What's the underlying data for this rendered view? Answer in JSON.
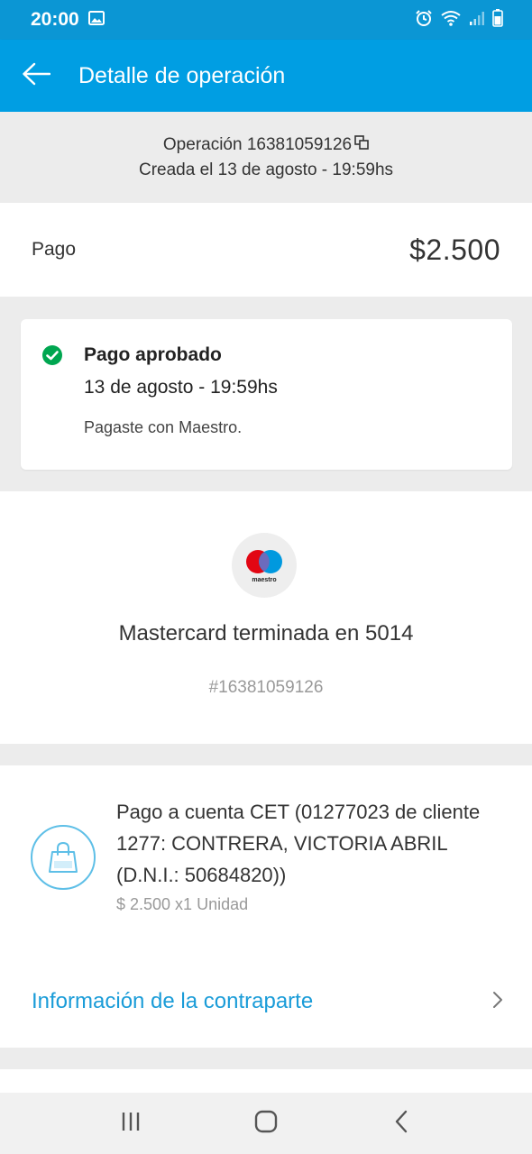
{
  "status_bar": {
    "time": "20:00",
    "icons": [
      "image-icon",
      "alarm-icon",
      "wifi-icon",
      "signal-icon",
      "battery-icon"
    ]
  },
  "app_bar": {
    "title": "Detalle de operación",
    "back_icon": "arrow-left-icon"
  },
  "operation": {
    "number_line": "Operación 16381059126",
    "copy_icon": "copy-icon",
    "created_line": "Creada el 13 de agosto - 19:59hs"
  },
  "payment": {
    "label": "Pago",
    "amount": "$2.500"
  },
  "status_card": {
    "title": "Pago aprobado",
    "date": "13 de agosto - 19:59hs",
    "method": "Pagaste con Maestro.",
    "status_color": "#00a650"
  },
  "card": {
    "brand_logo_text": "maestro",
    "name": "Mastercard terminada en 5014",
    "reference": "#16381059126"
  },
  "item": {
    "description": "Pago a cuenta CET (01277023 de cliente 1277: CONTRERA, VICTORIA ABRIL (D.N.I.: 50684820))",
    "price": "$ 2.500 x1 Unidad",
    "icon": "shopping-bag-icon"
  },
  "counterpart": {
    "label": "Información de la contraparte"
  },
  "colors": {
    "primary": "#009ee3",
    "status_bar": "#0b96d4",
    "link": "#1a9cd8",
    "success": "#00a650"
  },
  "nav_bar": {
    "buttons": [
      "recent-apps-icon",
      "home-icon",
      "back-icon"
    ]
  }
}
